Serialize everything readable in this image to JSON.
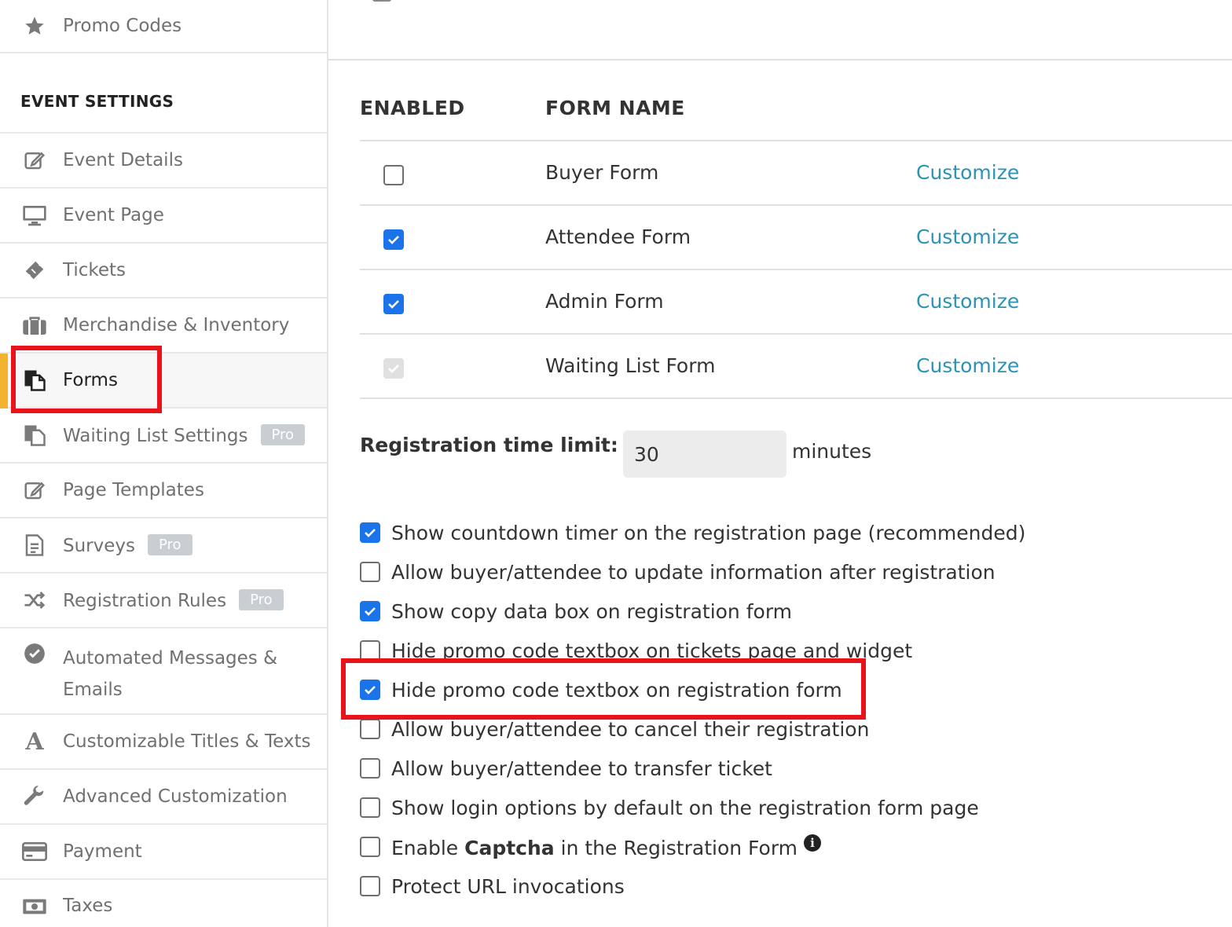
{
  "sidebar": {
    "promo_label": "Promo Codes",
    "section_title": "EVENT SETTINGS",
    "items": [
      {
        "label": "Event Details"
      },
      {
        "label": "Event Page"
      },
      {
        "label": "Tickets"
      },
      {
        "label": "Merchandise & Inventory"
      },
      {
        "label": "Forms"
      },
      {
        "label": "Waiting List Settings",
        "badge": "Pro"
      },
      {
        "label": "Page Templates"
      },
      {
        "label": "Surveys",
        "badge": "Pro"
      },
      {
        "label": "Registration Rules",
        "badge": "Pro"
      },
      {
        "label": "Automated Messages &",
        "label2": "Emails"
      },
      {
        "label": "Customizable Titles & Texts"
      },
      {
        "label": "Advanced Customization"
      },
      {
        "label": "Payment"
      },
      {
        "label": "Taxes"
      }
    ],
    "active_item": "Forms",
    "accent_color": "#f4b32e"
  },
  "forms_table": {
    "col_enabled": "ENABLED",
    "col_form_name": "FORM NAME",
    "rows": [
      {
        "name": "Buyer Form",
        "enabled": false,
        "link": "Customize"
      },
      {
        "name": "Attendee Form",
        "enabled": true,
        "link": "Customize"
      },
      {
        "name": "Admin Form",
        "enabled": true,
        "link": "Customize"
      },
      {
        "name": "Waiting List Form",
        "enabled": true,
        "disabled": true,
        "link": "Customize"
      }
    ],
    "link_color": "#2a93b8"
  },
  "registration_time": {
    "label": "Registration time limit:",
    "value": "30",
    "unit": "minutes"
  },
  "options": [
    {
      "text": "Show countdown timer on the registration page (recommended)",
      "checked": true
    },
    {
      "text": "Allow buyer/attendee to update information after registration",
      "checked": false
    },
    {
      "text": "Show copy data box on registration form",
      "checked": true
    },
    {
      "text": "Hide promo code textbox on tickets page and widget",
      "checked": false
    },
    {
      "text": "Hide promo code textbox on registration form",
      "checked": true
    },
    {
      "text": "Allow buyer/attendee to cancel their registration",
      "checked": false
    },
    {
      "text": "Allow buyer/attendee to transfer ticket",
      "checked": false
    },
    {
      "text": "Show login options by default on the registration form page",
      "checked": false
    },
    {
      "text_pre": "Enable ",
      "text_bold": "Captcha",
      "text_post": " in the Registration Form",
      "checked": false
    },
    {
      "text": "Protect URL invocations",
      "checked": false
    }
  ],
  "highlight_color": "#e8141b",
  "checkbox_color": "#1a73e8"
}
